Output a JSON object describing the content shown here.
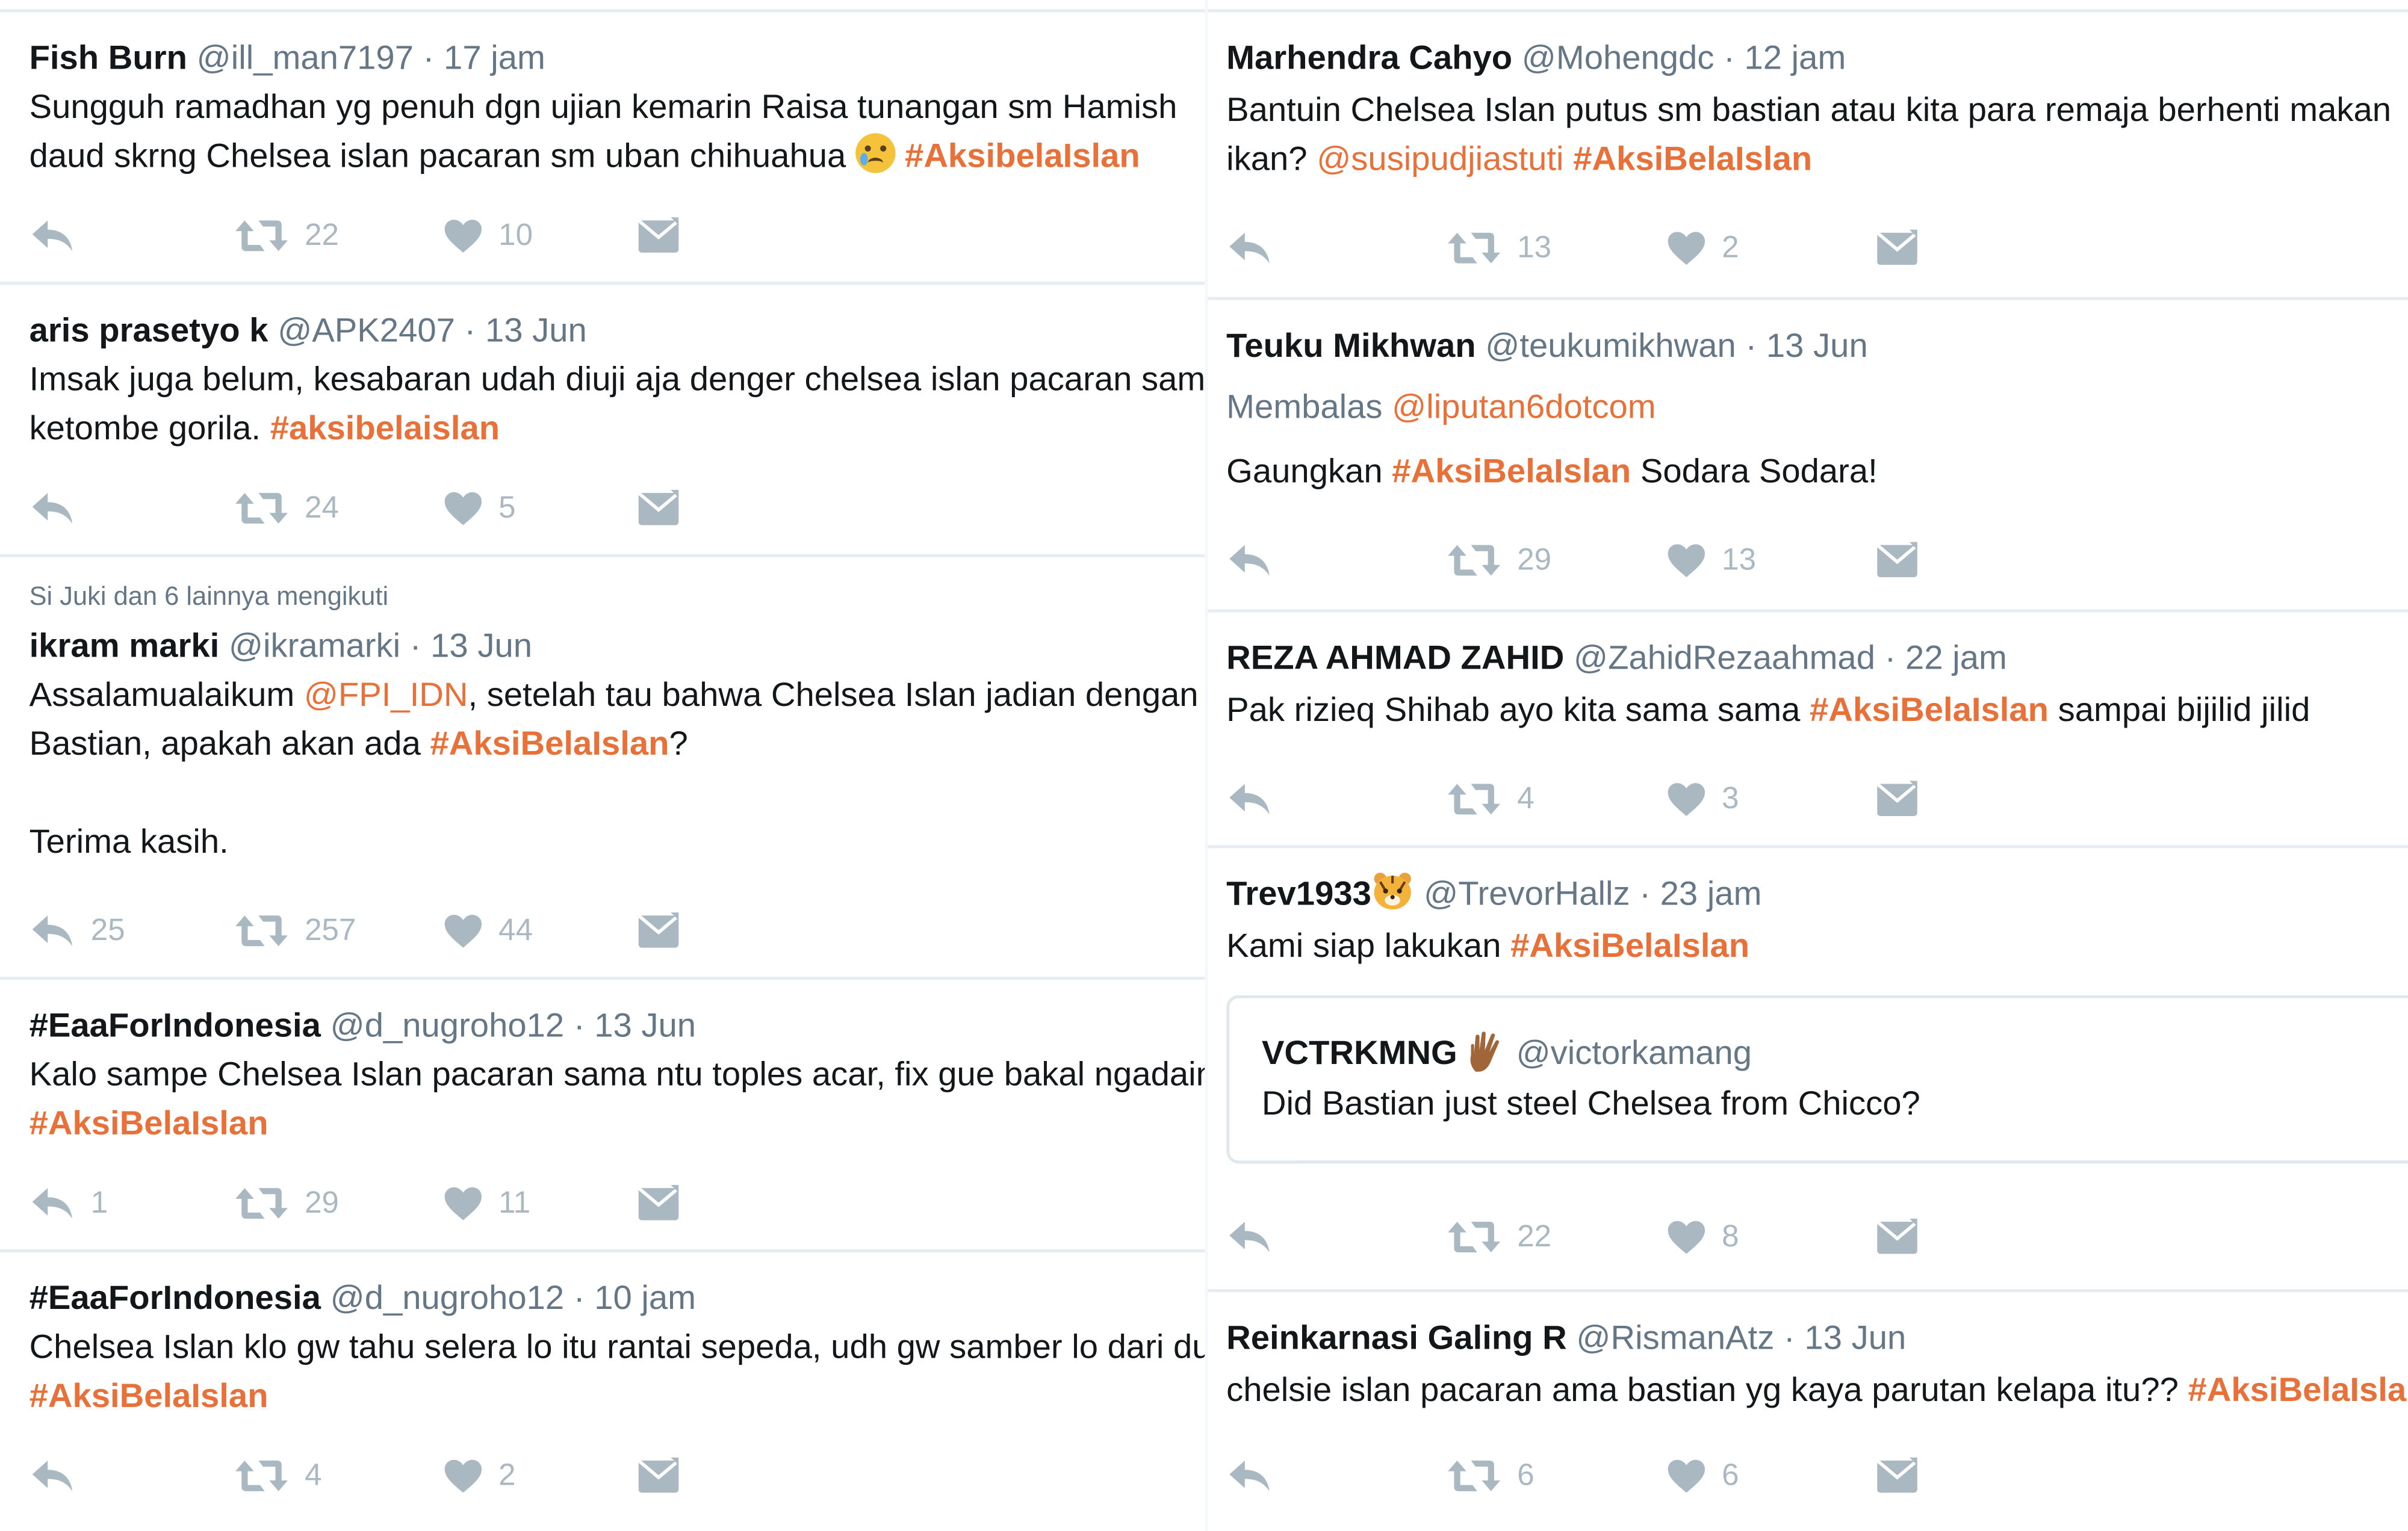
{
  "left_column": [
    {
      "fullname": "Fish Burn",
      "username": "@ill_man7197",
      "time": "17 jam",
      "line1": "Sungguh ramadhan yg penuh dgn ujian kemarin Raisa tunangan sm Hamish",
      "line2": "daud skrng Chelsea islan pacaran sm uban chihuahua",
      "emoji": "crying-face-emoji",
      "hashtag": "#AksibelaIslan",
      "retweets": "22",
      "likes": "10"
    },
    {
      "fullname": "aris prasetyo k",
      "username": "@APK2407",
      "time": "13 Jun",
      "line1": "Imsak juga belum, kesabaran udah diuji aja denger chelsea islan pacaran sama",
      "line2": "ketombe gorila.",
      "hashtag": "#aksibelaislan",
      "retweets": "24",
      "likes": "5"
    },
    {
      "social_context": "Si Juki dan 6 lainnya mengikuti",
      "fullname": "ikram marki",
      "username": "@ikramarki",
      "time": "13 Jun",
      "line1_a": "Assalamualaikum ",
      "mention": "@FPI_IDN",
      "line1_b": ", setelah tau bahwa Chelsea Islan jadian dengan",
      "line2_a": "Bastian, apakah akan ada ",
      "hashtag": "#AksiBelaIslan",
      "line2_b": "?",
      "line3": "Terima kasih.",
      "replies": "25",
      "retweets": "257",
      "likes": "44"
    },
    {
      "fullname": "#EaaForIndonesia",
      "username": "@d_nugroho12",
      "time": "13 Jun",
      "line1": "Kalo sampe Chelsea Islan pacaran sama ntu toples acar, fix gue bakal ngadain",
      "hashtag": "#AksiBelaIslan",
      "replies": "1",
      "retweets": "29",
      "likes": "11"
    },
    {
      "fullname": "#EaaForIndonesia",
      "username": "@d_nugroho12",
      "time": "10 jam",
      "line1": "Chelsea Islan klo gw tahu selera lo itu rantai sepeda, udh gw samber lo dari dulu",
      "hashtag": "#AksiBelaIslan",
      "retweets": "4",
      "likes": "2"
    }
  ],
  "right_column": [
    {
      "fullname": "Marhendra Cahyo",
      "username": "@Mohengdc",
      "time": "12 jam",
      "line1": "Bantuin Chelsea Islan putus sm bastian atau kita para remaja berhenti makan",
      "line2_a": "ikan? ",
      "mention": "@susipudjiastuti",
      "hashtag": "#AksiBelaIslan",
      "retweets": "13",
      "likes": "2"
    },
    {
      "fullname": "Teuku Mikhwan",
      "username": "@teukumikhwan",
      "time": "13 Jun",
      "reply_label": "Membalas ",
      "reply_to": "@liputan6dotcom",
      "line1_a": "Gaungkan ",
      "hashtag": "#AksiBelaIslan",
      "line1_b": " Sodara Sodara!",
      "retweets": "29",
      "likes": "13"
    },
    {
      "fullname": "REZA AHMAD ZAHID",
      "username": "@ZahidRezaahmad",
      "time": "22 jam",
      "line1_a": "Pak rizieq Shihab ayo kita sama sama ",
      "hashtag": "#AksiBelaIslan",
      "line1_b": " sampai bijilid jilid",
      "retweets": "4",
      "likes": "3"
    },
    {
      "fullname": "Trev1933",
      "emoji": "tiger-face-emoji",
      "username": "@TrevorHallz",
      "time": "23 jam",
      "line1_a": "Kami siap lakukan ",
      "hashtag": "#AksiBelaIslan",
      "quote": {
        "fullname": "VCTRKMNG",
        "emoji": "vulcan-salute-emoji",
        "username": "@victorkamang",
        "text": "Did Bastian just steel Chelsea from Chicco?"
      },
      "retweets": "22",
      "likes": "8"
    },
    {
      "fullname": "Reinkarnasi Galing R",
      "username": "@RismanAtz",
      "time": "13 Jun",
      "line1_a": "chelsie islan pacaran ama bastian yg kaya parutan kelapa itu?? ",
      "hashtag": "#AksiBelaIslan",
      "retweets": "6",
      "likes": "6"
    }
  ],
  "separator": "·",
  "colors": {
    "accent": "#e8713a",
    "muted": "#657786",
    "icon": "#aab8c2",
    "border": "#e6ecf0"
  },
  "icons": [
    "reply-icon",
    "retweet-icon",
    "like-icon",
    "direct-message-icon"
  ]
}
